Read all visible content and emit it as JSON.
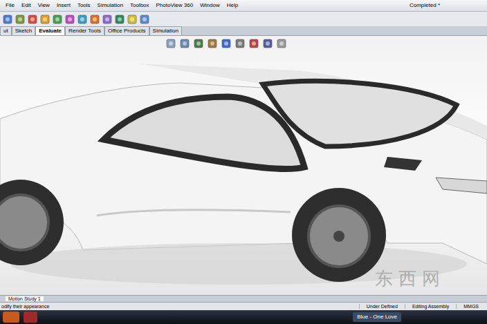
{
  "window": {
    "title": "Completed *"
  },
  "menu": [
    "File",
    "Edit",
    "View",
    "Insert",
    "Tools",
    "Simulation",
    "Toolbox",
    "PhotoView 360",
    "Window",
    "Help"
  ],
  "command_tabs": [
    {
      "label": "ut",
      "selected": false
    },
    {
      "label": "Sketch",
      "selected": false
    },
    {
      "label": "Evaluate",
      "selected": true
    },
    {
      "label": "Render Tools",
      "selected": false
    },
    {
      "label": "Office Products",
      "selected": false
    },
    {
      "label": "Simulation",
      "selected": false
    }
  ],
  "bottom_tabs": [
    {
      "label": "Motion Study 1",
      "selected": true
    }
  ],
  "status_bar": {
    "message": "odify their appearance",
    "items": [
      "Under Defined",
      "Editing Assembly",
      "MMGS"
    ]
  },
  "taskbar": {
    "items": [
      {
        "label": "Blue - One Love"
      }
    ]
  },
  "watermark": "东西网"
}
